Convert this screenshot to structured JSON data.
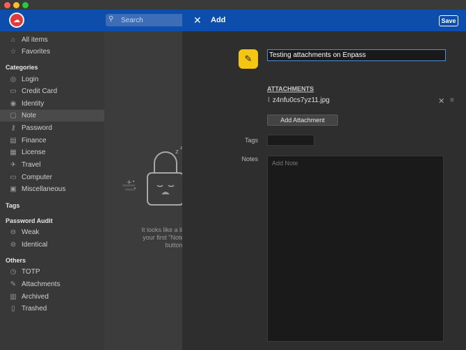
{
  "window": {
    "controls": [
      "close",
      "minimize",
      "zoom"
    ]
  },
  "search": {
    "placeholder": "Search"
  },
  "sidebar": {
    "top": [
      {
        "label": "All items",
        "icon": "home-icon"
      },
      {
        "label": "Favorites",
        "icon": "star-icon"
      }
    ],
    "categories_heading": "Categories",
    "categories_more": "•••",
    "categories": [
      {
        "label": "Login",
        "icon": "globe-icon"
      },
      {
        "label": "Credit Card",
        "icon": "credit-card-icon"
      },
      {
        "label": "Identity",
        "icon": "identity-icon"
      },
      {
        "label": "Note",
        "icon": "note-icon",
        "active": true
      },
      {
        "label": "Password",
        "icon": "key-icon"
      },
      {
        "label": "Finance",
        "icon": "finance-icon"
      },
      {
        "label": "License",
        "icon": "license-icon"
      },
      {
        "label": "Travel",
        "icon": "travel-icon"
      },
      {
        "label": "Computer",
        "icon": "computer-icon"
      },
      {
        "label": "Miscellaneous",
        "icon": "misc-icon"
      }
    ],
    "tags_heading": "Tags",
    "tags_add": "+",
    "audit_heading": "Password Audit",
    "audit": [
      {
        "label": "Weak",
        "icon": "weak-icon"
      },
      {
        "label": "Identical",
        "icon": "identical-icon"
      }
    ],
    "others_heading": "Others",
    "others": [
      {
        "label": "TOTP",
        "icon": "totp-icon"
      },
      {
        "label": "Attachments",
        "icon": "paperclip-icon"
      },
      {
        "label": "Archived",
        "icon": "archive-icon"
      },
      {
        "label": "Trashed",
        "icon": "trash-icon"
      }
    ]
  },
  "empty_state": {
    "line1": "It looks like a little empt",
    "line2": "your first \"Note\" item u",
    "line3": "button"
  },
  "panel": {
    "title": "Add",
    "save_label": "Save",
    "item_title": "Testing attachments on Enpass",
    "attachments_heading": "ATTACHMENTS",
    "attachment_name": "z4nfu0cs7yz11.jpg",
    "add_attachment_label": "Add Attachment",
    "tags_label": "Tags",
    "notes_label": "Notes",
    "notes_placeholder": "Add Note"
  },
  "colors": {
    "accent": "#0d4dab",
    "icon_yellow": "#f4c612"
  }
}
